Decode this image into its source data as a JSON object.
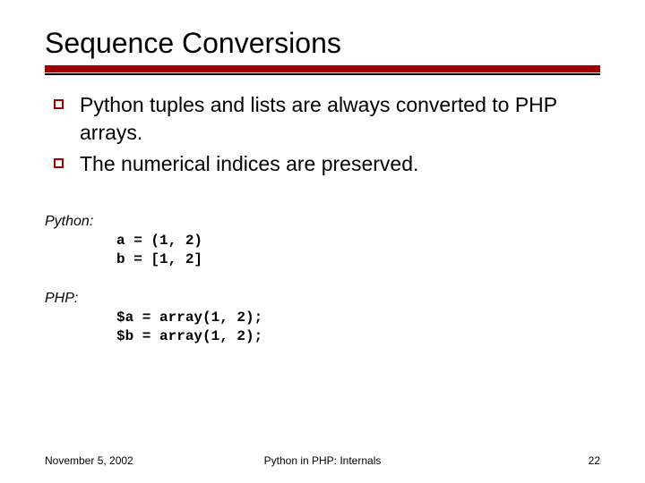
{
  "title": "Sequence Conversions",
  "bullets": [
    "Python tuples and lists are always converted to PHP arrays.",
    "The numerical indices are preserved."
  ],
  "sections": [
    {
      "label": "Python:",
      "code": "a = (1, 2)\nb = [1, 2]"
    },
    {
      "label": "PHP:",
      "code": "$a = array(1, 2);\n$b = array(1, 2);"
    }
  ],
  "footer": {
    "date": "November 5, 2002",
    "center": "Python in PHP: Internals",
    "page": "22"
  }
}
